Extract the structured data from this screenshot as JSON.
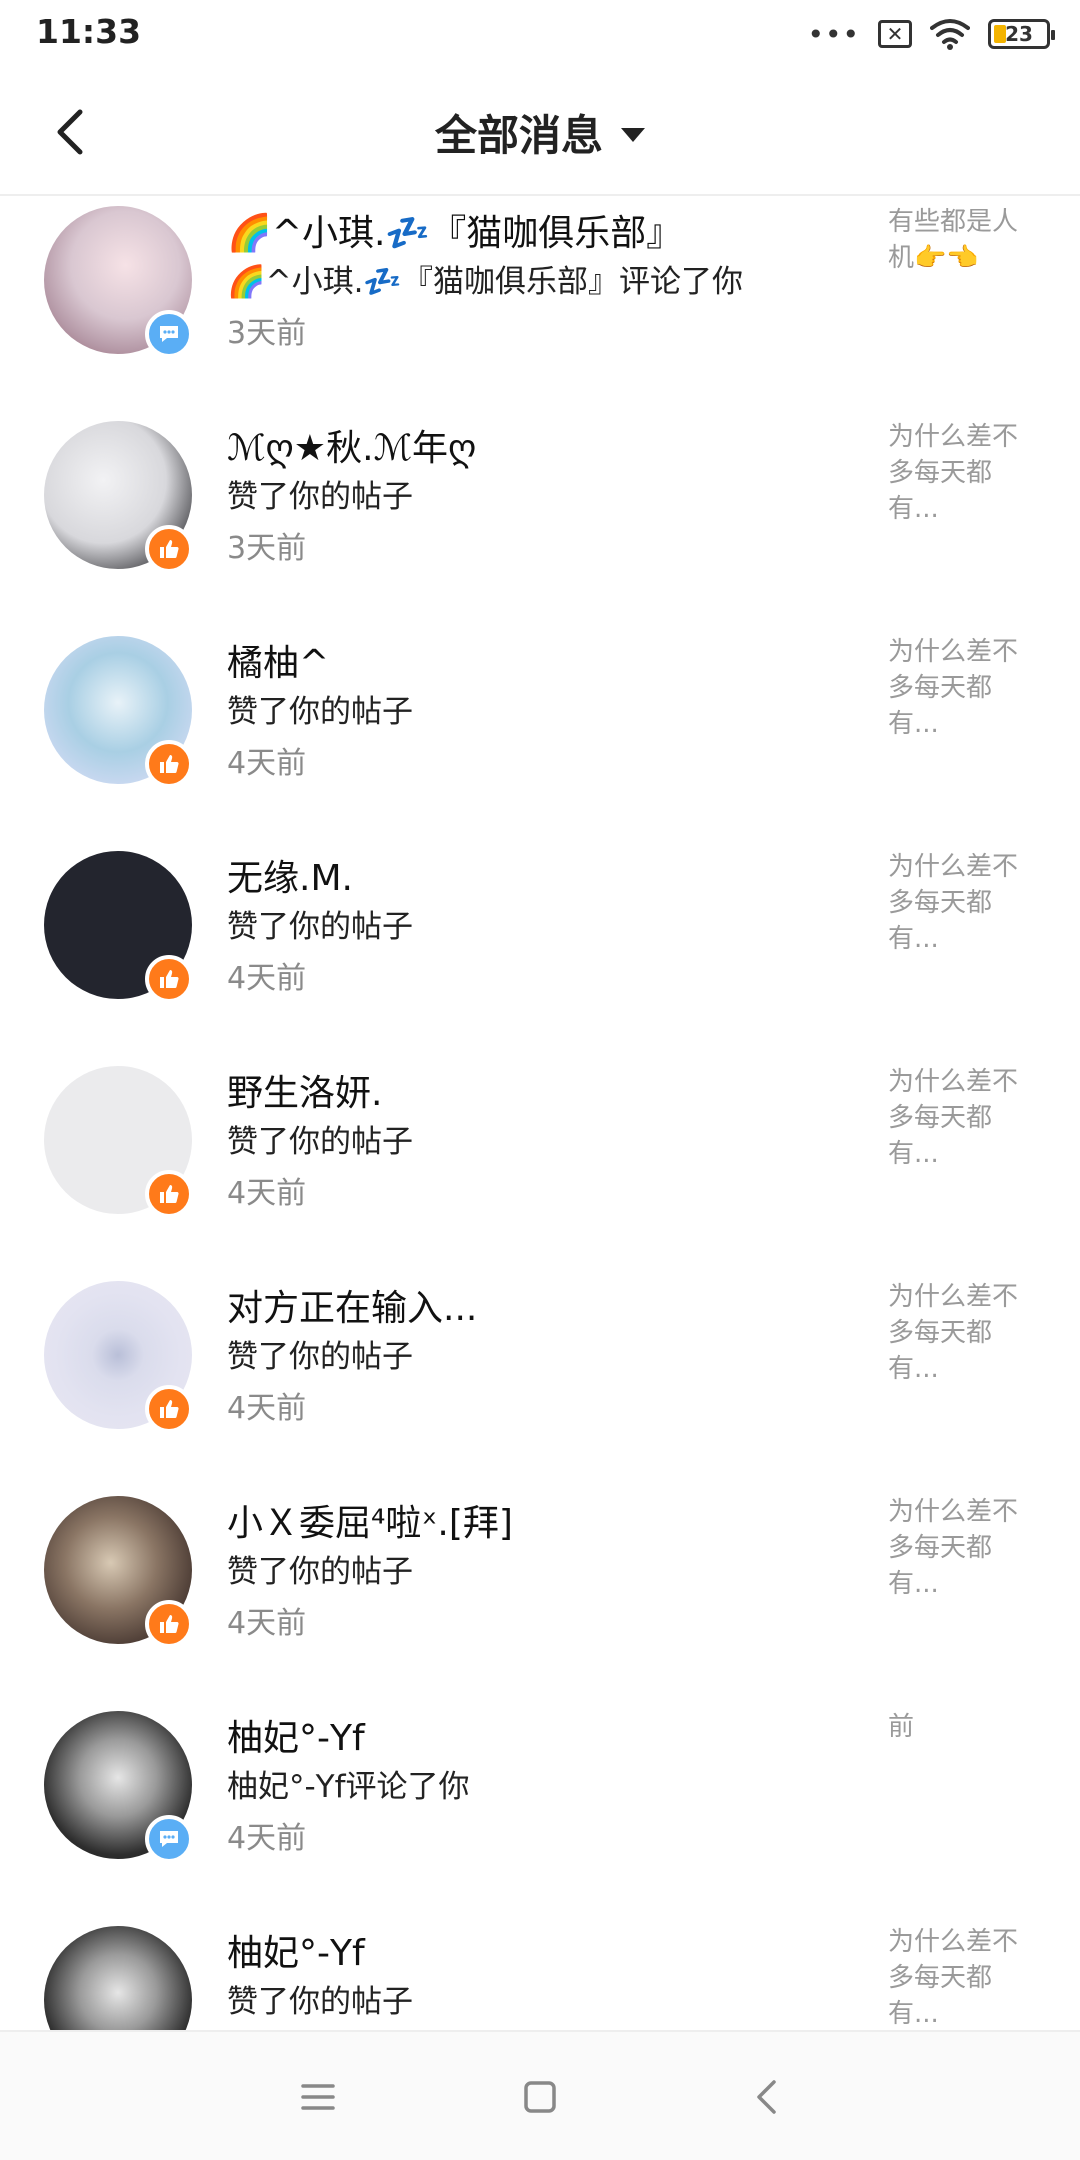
{
  "status": {
    "time": "11:33",
    "dots": "•••",
    "sim": "✕",
    "battery": "23"
  },
  "header": {
    "title": "全部消息"
  },
  "colors": {
    "like_badge": "#ff7a1a",
    "comment_badge": "#5aaef5"
  },
  "items": [
    {
      "name": "🌈^小琪.💤『猫咖俱乐部』",
      "action": "🌈^小琪.💤『猫咖俱乐部』评论了你",
      "time": "3天前",
      "preview": "有些都是人机👉👈",
      "type": "comment"
    },
    {
      "name": "ℳღ★秋.ℳ年ღ",
      "action": "赞了你的帖子",
      "time": "3天前",
      "preview": "为什么差不多每天都有...",
      "type": "like"
    },
    {
      "name": "橘柚^",
      "action": "赞了你的帖子",
      "time": "4天前",
      "preview": "为什么差不多每天都有...",
      "type": "like"
    },
    {
      "name": "无缘.M.",
      "action": "赞了你的帖子",
      "time": "4天前",
      "preview": "为什么差不多每天都有...",
      "type": "like"
    },
    {
      "name": "野生洛妍.",
      "action": "赞了你的帖子",
      "time": "4天前",
      "preview": "为什么差不多每天都有...",
      "type": "like"
    },
    {
      "name": "对方正在输入...",
      "action": "赞了你的帖子",
      "time": "4天前",
      "preview": "为什么差不多每天都有...",
      "type": "like"
    },
    {
      "name": "小Ｘ委屈⁴啦ˣ.[拜]",
      "action": "赞了你的帖子",
      "time": "4天前",
      "preview": "为什么差不多每天都有...",
      "type": "like"
    },
    {
      "name": "柚妃°-Yf",
      "action": "柚妃°-Yf评论了你",
      "time": "4天前",
      "preview": "前",
      "type": "comment"
    },
    {
      "name": "柚妃°-Yf",
      "action": "赞了你的帖子",
      "time": "",
      "preview": "为什么差不多每天都有...",
      "type": "like"
    }
  ]
}
